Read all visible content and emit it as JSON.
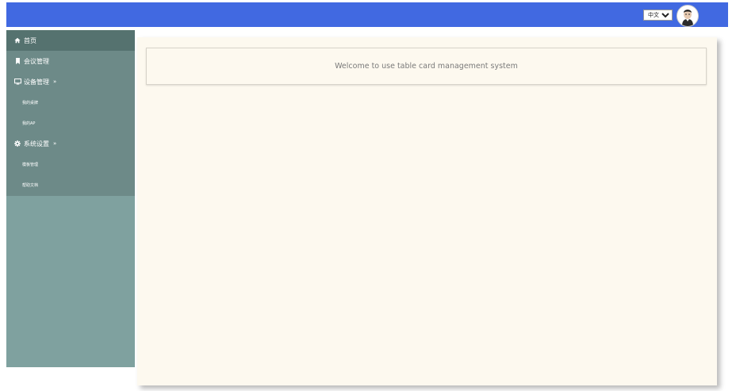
{
  "header": {
    "language_select": {
      "value": "中文简体",
      "options": [
        "中文简体"
      ]
    },
    "avatar_icon": "user-avatar-icon"
  },
  "sidebar": {
    "items": [
      {
        "label": "首页",
        "icon": "home-icon",
        "active": true
      },
      {
        "label": "会议管理",
        "icon": "bookmark-icon"
      },
      {
        "label": "设备管理",
        "icon": "monitor-icon",
        "arrow": "»"
      },
      {
        "label": "我的桌牌",
        "sub": true
      },
      {
        "label": "我的AP",
        "sub": true
      },
      {
        "label": "系统设置",
        "icon": "gear-icon",
        "arrow": "»"
      },
      {
        "label": "模板管理",
        "sub": true
      },
      {
        "label": "帮助文档",
        "sub": true
      }
    ]
  },
  "main": {
    "welcome_text": "Welcome to use table card management system"
  },
  "colors": {
    "topbar": "#4169e1",
    "sidebar": "#7fa19f",
    "sidebar_menu": "#6d8a88",
    "sidebar_active": "#55726f",
    "panel": "#fdf9ef"
  }
}
